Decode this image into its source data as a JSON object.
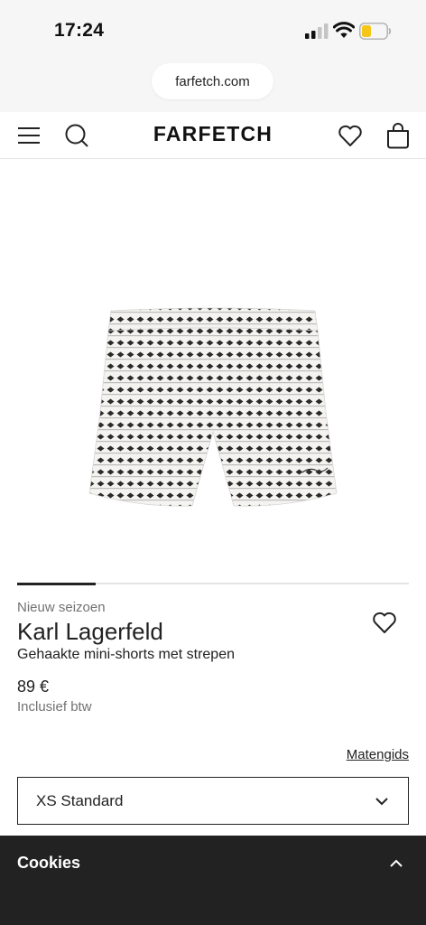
{
  "status_bar": {
    "time": "17:24",
    "icons": [
      "signal-icon",
      "wifi-icon",
      "battery-icon"
    ],
    "battery_color": "#f5c518"
  },
  "browser": {
    "url": "farfetch.com"
  },
  "header": {
    "logo": "FARFETCH",
    "icons": [
      "menu-icon",
      "search-icon",
      "heart-icon",
      "bag-icon"
    ]
  },
  "product": {
    "image_icon": "striped-shorts-image",
    "carousel_progress": 0.2,
    "season": "Nieuw seizoen",
    "brand": "Karl Lagerfeld",
    "description": "Gehaakte mini-shorts met strepen",
    "price": "89 €",
    "vat_note": "Inclusief btw"
  },
  "size": {
    "guide_label": "Matengids",
    "selected": "XS Standard"
  },
  "cookies": {
    "title": "Cookies"
  },
  "colors": {
    "text": "#222222",
    "muted": "#727272",
    "banner": "#222222"
  }
}
